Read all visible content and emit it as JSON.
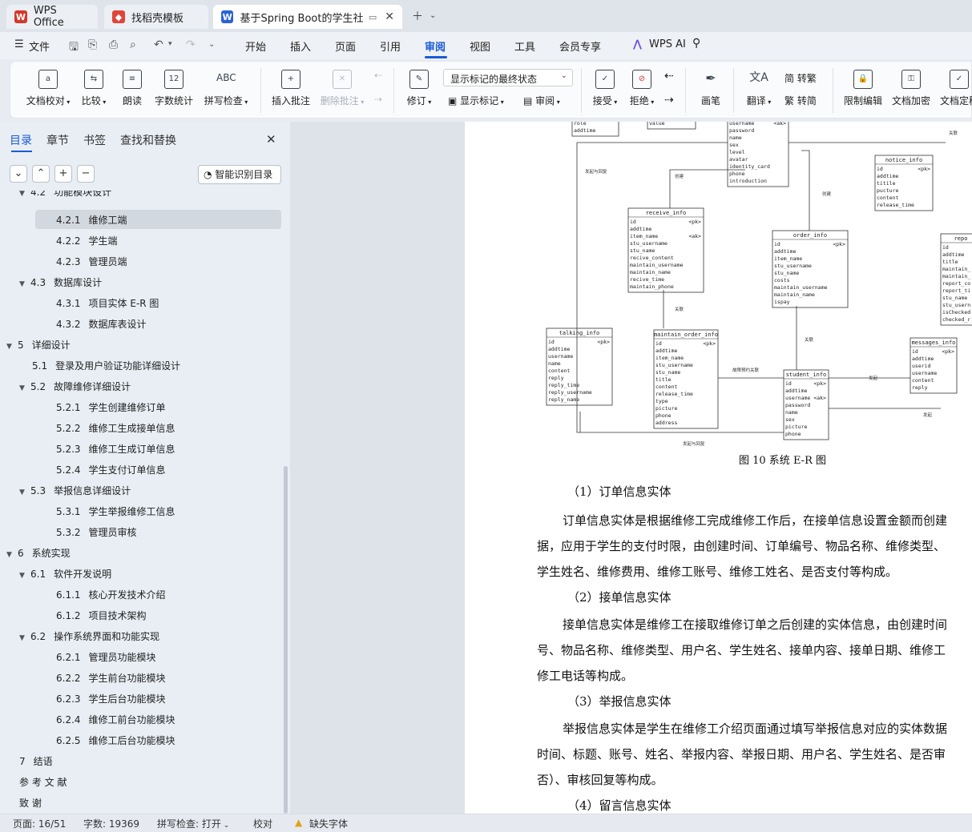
{
  "tabs": [
    {
      "label": "WPS Office",
      "icon": "wps-logo-icon"
    },
    {
      "label": "找稻壳模板",
      "icon": "daoke-logo-icon"
    },
    {
      "label": "基于Spring Boot的学生社区故障维修预约系统的设计与实现",
      "icon": "wps-writer-icon"
    }
  ],
  "menu": {
    "file": "文件",
    "items": [
      "开始",
      "插入",
      "页面",
      "引用",
      "审阅",
      "视图",
      "工具",
      "会员专享"
    ],
    "active": "审阅",
    "wps_ai": "WPS AI"
  },
  "ribbon": {
    "proofread": "文档校对",
    "compare": "比较",
    "read_aloud": "朗读",
    "word_count": "字数统计",
    "spell_check": "拼写检查",
    "insert_comment": "插入批注",
    "delete_comment": "删除批注",
    "track_changes": "修订",
    "markup_mode": "显示标记的最终状态",
    "show_markup": "显示标记",
    "review": "审阅",
    "accept": "接受",
    "reject": "拒绝",
    "ink": "画笔",
    "translate": "翻译",
    "to_traditional": "转繁",
    "to_simplified": "转简",
    "restrict_edit": "限制编辑",
    "encrypt": "文档加密",
    "finalize": "文档定稿"
  },
  "nav": {
    "tabs": [
      "目录",
      "章节",
      "书签",
      "查找和替换"
    ],
    "smart_toc": "智能识别目录",
    "toc": [
      {
        "num": "4.2",
        "text": "功能模块设计",
        "level": 2,
        "arrow": "▼"
      },
      {
        "num": "4.2.1",
        "text": "维修工端",
        "level": 3,
        "selected": true
      },
      {
        "num": "4.2.2",
        "text": "学生端",
        "level": 3
      },
      {
        "num": "4.2.3",
        "text": "管理员端",
        "level": 3
      },
      {
        "num": "4.3",
        "text": "数据库设计",
        "level": 2,
        "arrow": "▼"
      },
      {
        "num": "4.3.1",
        "text": "项目实体 E-R 图",
        "level": 3
      },
      {
        "num": "4.3.2",
        "text": "数据库表设计",
        "level": 3
      },
      {
        "num": "5",
        "text": "详细设计",
        "level": 1,
        "arrow": "▼"
      },
      {
        "num": "5.1",
        "text": "登录及用户验证功能详细设计",
        "level": 2
      },
      {
        "num": "5.2",
        "text": "故障维修详细设计",
        "level": 2,
        "arrow": "▼"
      },
      {
        "num": "5.2.1",
        "text": "学生创建维修订单",
        "level": 3
      },
      {
        "num": "5.2.2",
        "text": "维修工生成接单信息",
        "level": 3
      },
      {
        "num": "5.2.3",
        "text": "维修工生成订单信息",
        "level": 3
      },
      {
        "num": "5.2.4",
        "text": "学生支付订单信息",
        "level": 3
      },
      {
        "num": "5.3",
        "text": "举报信息详细设计",
        "level": 2,
        "arrow": "▼"
      },
      {
        "num": "5.3.1",
        "text": "学生举报维修工信息",
        "level": 3
      },
      {
        "num": "5.3.2",
        "text": "管理员审核",
        "level": 3
      },
      {
        "num": "6",
        "text": "系统实现",
        "level": 1,
        "arrow": "▼"
      },
      {
        "num": "6.1",
        "text": "软件开发说明",
        "level": 2,
        "arrow": "▼"
      },
      {
        "num": "6.1.1",
        "text": "核心开发技术介绍",
        "level": 3
      },
      {
        "num": "6.1.2",
        "text": "项目技术架构",
        "level": 3
      },
      {
        "num": "6.2",
        "text": "操作系统界面和功能实现",
        "level": 2,
        "arrow": "▼"
      },
      {
        "num": "6.2.1",
        "text": "管理员功能模块",
        "level": 3
      },
      {
        "num": "6.2.2",
        "text": "学生前台功能模块",
        "level": 3
      },
      {
        "num": "6.2.3",
        "text": "学生后台功能模块",
        "level": 3
      },
      {
        "num": "6.2.4",
        "text": "维修工前台功能模块",
        "level": 3
      },
      {
        "num": "6.2.5",
        "text": "维修工后台功能模块",
        "level": 3
      },
      {
        "num": "7",
        "text": "结语",
        "level": 1
      },
      {
        "num": "",
        "text": "参 考 文 献",
        "level": 1
      },
      {
        "num": "",
        "text": "致      谢",
        "level": 1
      }
    ]
  },
  "document": {
    "figure_caption": "图 10  系统 E-R 图",
    "paragraphs": [
      "（1）订单信息实体",
      "订单信息实体是根据维修工完成维修工作后，在接单信息设置金额而创建",
      "据，应用于学生的支付时限，由创建时间、订单编号、物品名称、维修类型、",
      "学生姓名、维修费用、维修工账号、维修工姓名、是否支付等构成。",
      "（2）接单信息实体",
      "接单信息实体是维修工在接取维修订单之后创建的实体信息，由创建时间",
      "号、物品名称、维修类型、用户名、学生姓名、接单内容、接单日期、维修工",
      "修工电话等构成。",
      "（3）举报信息实体",
      "举报信息实体是学生在维修工介绍页面通过填写举报信息对应的实体数据",
      "时间、标题、账号、姓名、举报内容、举报日期、用户名、学生姓名、是否审",
      "否）、审核回复等构成。",
      "（4）留言信息实体"
    ],
    "er": {
      "entities": [
        {
          "name": "",
          "fields": [
            "role",
            "addtime"
          ]
        },
        {
          "name": "",
          "fields": [
            "value"
          ]
        },
        {
          "name": "",
          "fields": [
            "username  <ak>",
            "password",
            "name",
            "sex",
            "level",
            "avatar",
            "identity_card",
            "phone",
            "introduction"
          ]
        },
        {
          "name": "notice_info",
          "fields": [
            "id  <pk>",
            "addtime",
            "titile",
            "pucture",
            "content",
            "release_time"
          ]
        },
        {
          "name": "receive_info",
          "fields": [
            "id  <pk>",
            "addtime",
            "item_name  <ak>",
            "stu_username",
            "stu_name",
            "recive_content",
            "maintain_username",
            "maintain_name",
            "recive_time",
            "maintain_phone"
          ]
        },
        {
          "name": "order_info",
          "fields": [
            "id  <pk>",
            "addtime",
            "item_name",
            "stu_username",
            "stu_name",
            "costs",
            "maintain_username",
            "maintain_name",
            "ispay"
          ]
        },
        {
          "name": "repo",
          "fields": [
            "id",
            "addtime",
            "title",
            "maintain_",
            "maintain_",
            "report_co",
            "report_ti",
            "stu_name",
            "stu_usern",
            "isChecked",
            "checked_r"
          ]
        },
        {
          "name": "talking_info",
          "fields": [
            "id  <pk>",
            "addtime",
            "username",
            "name",
            "content",
            "reply",
            "reply_time",
            "reply_username",
            "reply_name"
          ]
        },
        {
          "name": "maintain_order_info",
          "fields": [
            "id  <pk>",
            "addtime",
            "item_name",
            "stu_username",
            "stu_name",
            "title",
            "content",
            "release_time",
            "type",
            "picture",
            "phone",
            "address"
          ]
        },
        {
          "name": "student_info",
          "fields": [
            "id  <pk>",
            "addtime",
            "username  <ak>",
            "password",
            "name",
            "sex",
            "picture",
            "phone"
          ]
        },
        {
          "name": "messages_info",
          "fields": [
            "id  <pk>",
            "addtime",
            "userid",
            "username",
            "content",
            "reply"
          ]
        }
      ],
      "relations": [
        "发起与回复",
        "创建",
        "创建",
        "关联",
        "关联",
        "关联",
        "故障预约",
        "发起",
        "发起",
        "发起与回复",
        "关联"
      ]
    }
  },
  "status": {
    "page": "页面: 16/51",
    "words": "字数: 19369",
    "spell": "拼写检查: 打开",
    "proof": "校对",
    "missing_font": "缺失字体"
  },
  "colors": {
    "accent": "#1a5ad6",
    "wps_red": "#d4382c"
  }
}
